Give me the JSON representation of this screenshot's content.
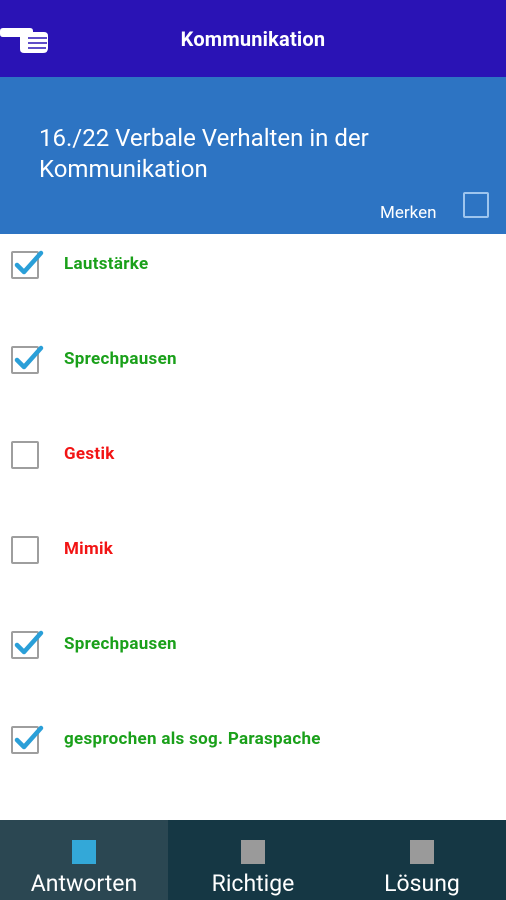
{
  "header": {
    "title": "Kommunikation",
    "back_icon": "pointing-hand-icon"
  },
  "question": {
    "text": "16./22 Verbale Verhalten in der Kommunikation",
    "merken_label": "Merken",
    "merken_checked": false
  },
  "colors": {
    "correct": "#1aa01a",
    "wrong": "#f21414",
    "check": "#2a9fd8"
  },
  "answers": [
    {
      "label": "Lautstärke",
      "checked": true,
      "status": "correct"
    },
    {
      "label": "Sprechpausen",
      "checked": true,
      "status": "correct"
    },
    {
      "label": "Gestik",
      "checked": false,
      "status": "wrong"
    },
    {
      "label": "Mimik",
      "checked": false,
      "status": "wrong"
    },
    {
      "label": "Sprechpausen",
      "checked": true,
      "status": "correct"
    },
    {
      "label": "gesprochen als sog. Paraspache",
      "checked": true,
      "status": "correct"
    }
  ],
  "tabs": [
    {
      "label": "Antworten",
      "active": true,
      "icon_color": "#33a8d8"
    },
    {
      "label": "Richtige",
      "active": false,
      "icon_color": "#9a9a9a"
    },
    {
      "label": "Lösung",
      "active": false,
      "icon_color": "#9a9a9a"
    }
  ]
}
